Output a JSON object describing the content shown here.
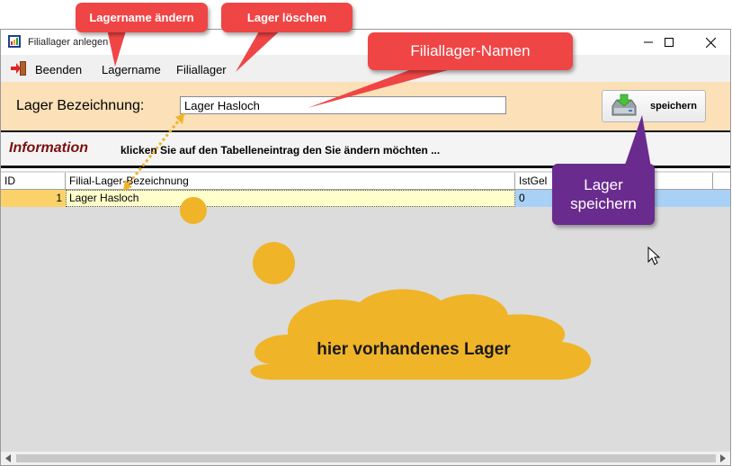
{
  "window": {
    "title": "Filiallager anlegen",
    "controls": {
      "minimize": "minimize-icon",
      "maximize": "maximize-icon",
      "close": "close-icon"
    }
  },
  "menu": {
    "exit_label": "Beenden",
    "items": [
      {
        "label": "Lagername"
      },
      {
        "label": "Filiallager"
      }
    ]
  },
  "form": {
    "label": "Lager Bezeichnung:",
    "name_value": "Lager Hasloch",
    "save_label": "speichern"
  },
  "info": {
    "title": "Information",
    "text": "klicken Sie auf den Tabelleneintrag den Sie ändern möchten ..."
  },
  "grid": {
    "columns": [
      "ID",
      "Filial-Lager-Bezeichnung",
      "IstGel"
    ],
    "rows": [
      {
        "id": "1",
        "name": "Lager Hasloch",
        "ist": "0"
      }
    ]
  },
  "annotations": {
    "rename": "Lagername ändern",
    "delete": "Lager löschen",
    "names": "Filiallager-Namen",
    "save_line1": "Lager",
    "save_line2": "speichern",
    "cloud": "hier vorhandenes Lager"
  },
  "colors": {
    "form_band": "#fbe0b8",
    "selected_row": "#a9d1f5",
    "callout_red": "#f04545",
    "callout_purple": "#6a2b8f",
    "highlight_yellow": "#f0b429",
    "info_title": "#7a1010"
  }
}
